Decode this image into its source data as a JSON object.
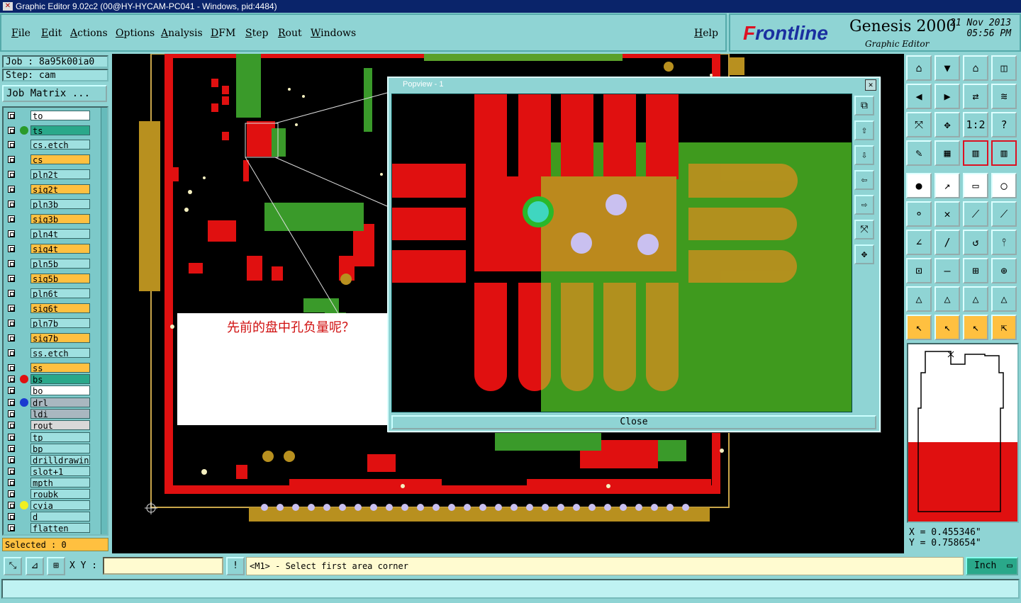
{
  "window": {
    "title": "Graphic Editor 9.02c2 (00@HY-HYCAM-PC041 - Windows, pid:4484)"
  },
  "menu": [
    "File",
    "Edit",
    "Actions",
    "Options",
    "Analysis",
    "DFM",
    "Step",
    "Rout",
    "Windows"
  ],
  "help": "Help",
  "brand": {
    "logo_prefix": "F",
    "logo_rest": "rontline",
    "product": "Genesis 2000",
    "subtitle": "Graphic Editor",
    "date": "21 Nov 2013",
    "time": "05:56 PM"
  },
  "job": {
    "job": "Job : 8a95k00ia0",
    "step": "Step: cam",
    "matrix_button": "Job Matrix ..."
  },
  "layers": [
    {
      "name": "to",
      "color": "#ffffff",
      "dot": ""
    },
    {
      "name": "ts",
      "color": "#2aa88a",
      "dot": "#2a9a2a"
    },
    {
      "name": "cs.etch",
      "color": "#9fe0e0",
      "dot": ""
    },
    {
      "name": "cs",
      "color": "#ffc040",
      "dot": ""
    },
    {
      "name": "pln2t",
      "color": "#9fe0e0",
      "dot": ""
    },
    {
      "name": "sig2t",
      "color": "#ffc040",
      "dot": ""
    },
    {
      "name": "pln3b",
      "color": "#9fe0e0",
      "dot": ""
    },
    {
      "name": "sig3b",
      "color": "#ffc040",
      "dot": ""
    },
    {
      "name": "pln4t",
      "color": "#9fe0e0",
      "dot": ""
    },
    {
      "name": "sig4t",
      "color": "#ffc040",
      "dot": ""
    },
    {
      "name": "pln5b",
      "color": "#9fe0e0",
      "dot": ""
    },
    {
      "name": "sig5b",
      "color": "#ffc040",
      "dot": ""
    },
    {
      "name": "pln6t",
      "color": "#9fe0e0",
      "dot": ""
    },
    {
      "name": "sig6t",
      "color": "#ffc040",
      "dot": ""
    },
    {
      "name": "pln7b",
      "color": "#9fe0e0",
      "dot": ""
    },
    {
      "name": "sig7b",
      "color": "#ffc040",
      "dot": ""
    },
    {
      "name": "ss.etch",
      "color": "#9fe0e0",
      "dot": ""
    },
    {
      "name": "ss",
      "color": "#ffc040",
      "dot": ""
    },
    {
      "name": "bs",
      "color": "#2aa88a",
      "dot": "#e01010"
    },
    {
      "name": "bo",
      "color": "#ffffff",
      "dot": ""
    },
    {
      "name": "drl",
      "color": "#a9b7c0",
      "dot": "#1a3ad0"
    },
    {
      "name": "ldi",
      "color": "#a9b7c0",
      "dot": ""
    },
    {
      "name": "rout",
      "color": "#d8d8d8",
      "dot": ""
    },
    {
      "name": "tp",
      "color": "#9fe0e0",
      "dot": ""
    },
    {
      "name": "bp",
      "color": "#9fe0e0",
      "dot": ""
    },
    {
      "name": "drilldrawing",
      "color": "#9fe0e0",
      "dot": ""
    },
    {
      "name": "slot+1",
      "color": "#9fe0e0",
      "dot": ""
    },
    {
      "name": "mpth",
      "color": "#9fe0e0",
      "dot": ""
    },
    {
      "name": "roubk",
      "color": "#9fe0e0",
      "dot": ""
    },
    {
      "name": "cvia",
      "color": "#9fe0e0",
      "dot": "#f0f020"
    },
    {
      "name": "d",
      "color": "#9fe0e0",
      "dot": ""
    },
    {
      "name": "flatten",
      "color": "#9fe0e0",
      "dot": ""
    }
  ],
  "selected": "Selected : 0",
  "popview": {
    "title": "Popview - 1",
    "close": "Close"
  },
  "note": "先前的盘中孔负量呢？",
  "coords": {
    "x": "X = 0.455346\"",
    "y": "Y = 0.758654\""
  },
  "bottom": {
    "xy_label": "X Y :",
    "xy_value": "",
    "message": "<M1> - Select first area corner",
    "unit": "Inch"
  },
  "tools": [
    "home",
    "down",
    "house",
    "split",
    "left",
    "right",
    "swap",
    "zigzag",
    "fit",
    "center",
    "1:2",
    "help",
    "ruler",
    "grid",
    "layers-a",
    "layers-b"
  ],
  "tool_labels": [
    "⌂",
    "▼",
    "⌂",
    "◫",
    "◀",
    "▶",
    "⇄",
    "≋",
    "⤧",
    "✥",
    "1:2",
    "?",
    "✎",
    "▦",
    "▥",
    "▥"
  ],
  "edit_tools": [
    "●",
    "↗",
    "▭",
    "◯",
    "⚬",
    "✕",
    "⟋",
    "⟋",
    "∠",
    "/",
    "↺",
    "⫯",
    "⊡",
    "—",
    "⊞",
    "⊕",
    "△",
    "△",
    "△",
    "△",
    "↖",
    "↖",
    "↖",
    "⇱"
  ]
}
